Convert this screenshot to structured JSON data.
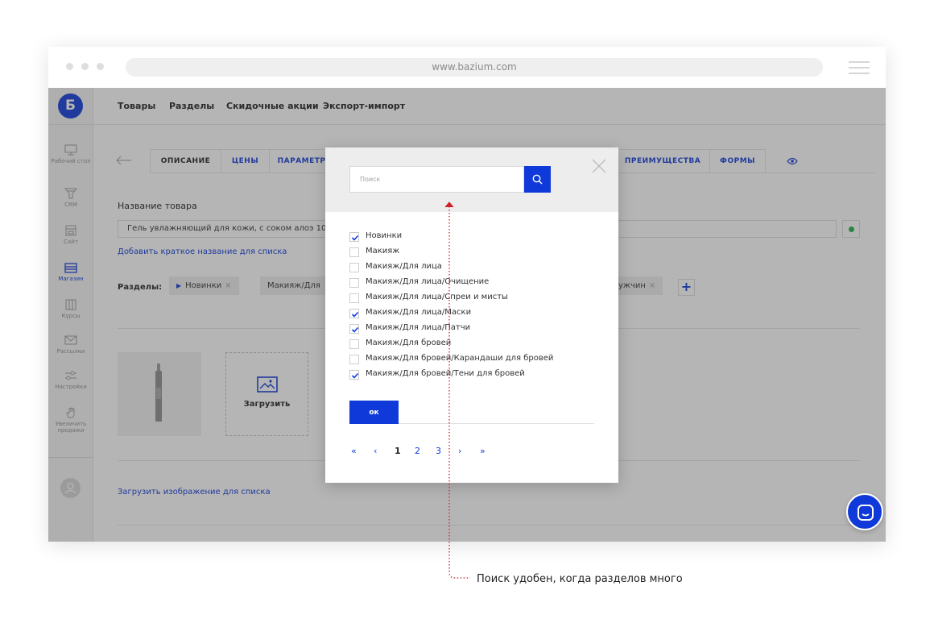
{
  "browser": {
    "url": "www.bazium.com"
  },
  "sidebar": {
    "logo_letter": "Б",
    "items": [
      {
        "label": "Рабочий стол",
        "icon": "desktop-icon"
      },
      {
        "label": "CRM",
        "icon": "crm-funnel-icon"
      },
      {
        "label": "Сайт",
        "icon": "site-icon"
      },
      {
        "label": "Магазин",
        "icon": "shop-icon",
        "active": true
      },
      {
        "label": "Курсы",
        "icon": "courses-icon"
      },
      {
        "label": "Рассылки",
        "icon": "mail-icon"
      },
      {
        "label": "Настройки",
        "icon": "settings-sliders-icon"
      },
      {
        "label": "Увеличить продажи",
        "icon": "hand-icon"
      }
    ]
  },
  "topnav": {
    "items": [
      "Товары",
      "Разделы",
      "Скидочные акции",
      "Экспорт-импорт"
    ]
  },
  "tabs": {
    "items": [
      "ОПИСАНИЕ",
      "ЦЕНЫ",
      "ПАРАМЕТРЫ",
      "ПРЕИМУЩЕСТВА",
      "ФОРМЫ"
    ],
    "active": "ОПИСАНИЕ"
  },
  "product": {
    "name_label": "Название товара",
    "name_value": "Гель увлажняющий для кожи, с соком алоэ 100",
    "short_name_link": "Добавить краткое название для списка",
    "status_color": "#1fb24a"
  },
  "sections": {
    "label": "Разделы:",
    "chips": [
      "Новинки",
      "Макияж/Для",
      "ужчин"
    ]
  },
  "media": {
    "upload_label": "Загрузить",
    "list_image_link": "Загрузить изображение для списка"
  },
  "modal": {
    "search_placeholder": "Поиск",
    "options": [
      {
        "label": "Новинки",
        "checked": true
      },
      {
        "label": "Макияж",
        "checked": false
      },
      {
        "label": "Макияж/Для лица",
        "checked": false
      },
      {
        "label": "Макияж/Для лица/Очищение",
        "checked": false
      },
      {
        "label": "Макияж/Для лица/Спреи и мисты",
        "checked": false
      },
      {
        "label": "Макияж/Для лица/Маски",
        "checked": true
      },
      {
        "label": "Макияж/Для лица/Патчи",
        "checked": true
      },
      {
        "label": "Макияж/Для бровей",
        "checked": false
      },
      {
        "label": "Макияж/Для бровей/Карандаши для бровей",
        "checked": false
      },
      {
        "label": "Макияж/Для бровей/Тени для бровей",
        "checked": true
      }
    ],
    "ok_label": "ок",
    "pager": {
      "first": "«",
      "prev": "‹",
      "pages": [
        "1",
        "2",
        "3"
      ],
      "current": "1",
      "next": "›",
      "last": "»"
    }
  },
  "annotation": {
    "text": "Поиск удобен, когда разделов много"
  },
  "colors": {
    "accent": "#0f3ad9",
    "annotation_line": "#d0212a"
  }
}
